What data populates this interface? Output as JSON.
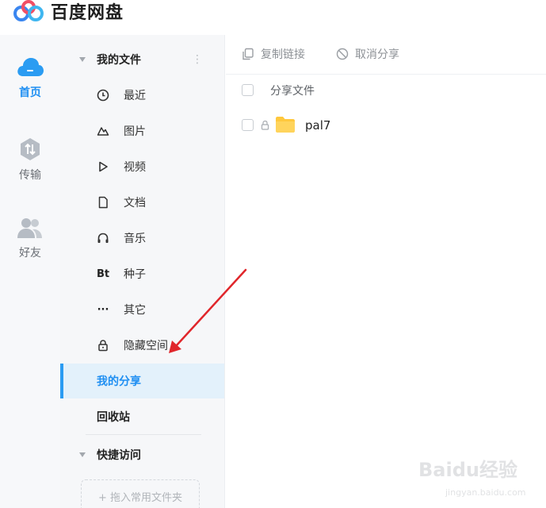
{
  "app": {
    "title": "百度网盘"
  },
  "rail": {
    "items": [
      {
        "label": "首页",
        "icon": "cloud-icon"
      },
      {
        "label": "传输",
        "icon": "transfer-icon"
      },
      {
        "label": "好友",
        "icon": "friends-icon"
      }
    ],
    "active_color": "#1f8ff2"
  },
  "sidebar": {
    "my_files": {
      "label": "我的文件",
      "more": "⋮"
    },
    "items": [
      {
        "label": "最近",
        "icon": "clock-icon"
      },
      {
        "label": "图片",
        "icon": "image-icon"
      },
      {
        "label": "视频",
        "icon": "play-icon"
      },
      {
        "label": "文档",
        "icon": "document-icon"
      },
      {
        "label": "音乐",
        "icon": "headphones-icon"
      },
      {
        "label": "种子",
        "icon": "bt-icon",
        "glyph": "Bt"
      },
      {
        "label": "其它",
        "icon": "more-icon",
        "glyph": "···"
      },
      {
        "label": "隐藏空间",
        "icon": "lock-icon"
      }
    ],
    "my_share": "我的分享",
    "recycle": "回收站",
    "quick_access": {
      "label": "快捷访问",
      "drop_hint": "+ 拖入常用文件夹"
    }
  },
  "toolbar": {
    "copy_link": "复制链接",
    "cancel_share": "取消分享"
  },
  "list": {
    "header": "分享文件",
    "rows": [
      {
        "name": "pal7",
        "type": "folder",
        "locked": true
      }
    ]
  },
  "colors": {
    "accent": "#1f8ff2",
    "folder": "#ffc83d",
    "annotation_arrow": "#e0262b"
  },
  "watermark": {
    "main": "Baidu经验",
    "sub": "jingyan.baidu.com"
  }
}
